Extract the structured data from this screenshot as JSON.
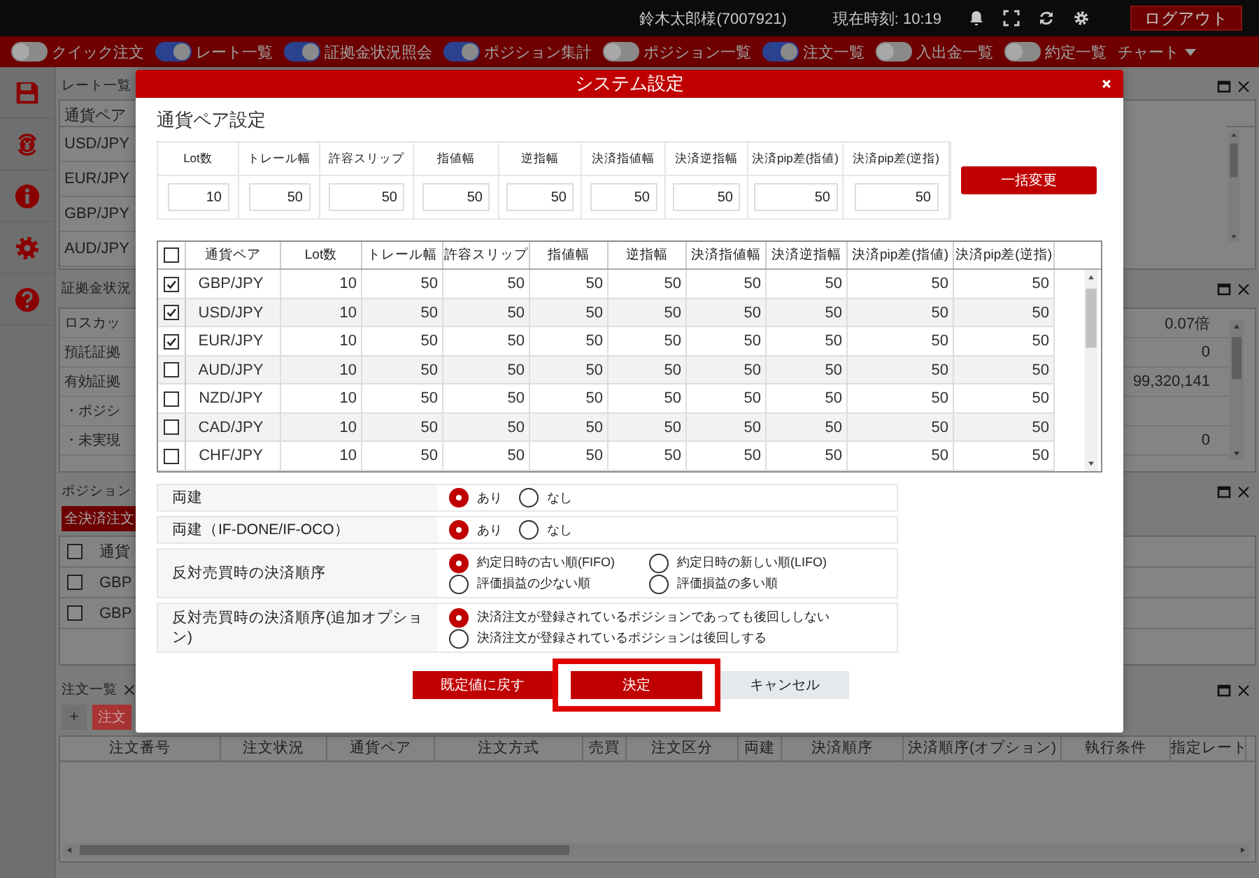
{
  "top_bar": {
    "user": "鈴木太郎様(7007921)",
    "clock": "現在時刻: 10:19",
    "logout": "ログアウト"
  },
  "nav": [
    {
      "label": "クイック注文",
      "kind": "toggle",
      "on": false
    },
    {
      "label": "レート一覧",
      "kind": "toggle",
      "on": true
    },
    {
      "label": "証拠金状況照会",
      "kind": "toggle",
      "on": true
    },
    {
      "label": "ポジション集計",
      "kind": "toggle",
      "on": true
    },
    {
      "label": "ポジション一覧",
      "kind": "toggle",
      "on": false
    },
    {
      "label": "注文一覧",
      "kind": "toggle",
      "on": true
    },
    {
      "label": "入出金一覧",
      "kind": "toggle",
      "on": false
    },
    {
      "label": "約定一覧",
      "kind": "toggle",
      "on": false
    },
    {
      "label": "チャート",
      "kind": "menu"
    }
  ],
  "rate_panel": {
    "title": "レート一覧",
    "column": "通貨ペア",
    "rows": [
      "USD/JPY",
      "EUR/JPY",
      "GBP/JPY",
      "AUD/JPY"
    ]
  },
  "margin_panel": {
    "title": "証拠金状況",
    "rows": [
      {
        "label": "ロスカッ",
        "value": "0.07倍"
      },
      {
        "label": "預託証拠",
        "value": "0"
      },
      {
        "label": "有効証拠",
        "value": "99,320,141"
      },
      {
        "label": "・ポジシ"
      },
      {
        "label": "・未実現",
        "value": "0"
      }
    ]
  },
  "position_panel": {
    "title": "ポジション",
    "button": "全決済注文",
    "column": "通貨",
    "all_checked": false,
    "rows": [
      {
        "pair": "GBP",
        "checked": false
      },
      {
        "pair": "GBP",
        "checked": false
      }
    ]
  },
  "order_panel": {
    "title": "注文一覧",
    "add": "+",
    "button": "注文",
    "columns": [
      "注文番号",
      "注文状況",
      "通貨ペア",
      "注文方式",
      "売買",
      "注文区分",
      "両建",
      "決済順序",
      "決済順序(オプション)",
      "執行条件",
      "指定レート"
    ]
  },
  "dialog": {
    "title": "システム設定",
    "section": "通貨ペア設定",
    "bulk": {
      "columns": [
        "Lot数",
        "トレール幅",
        "許容スリップ",
        "指値幅",
        "逆指幅",
        "決済指値幅",
        "決済逆指幅",
        "決済pip差(指値)",
        "決済pip差(逆指)"
      ],
      "values": [
        "10",
        "50",
        "50",
        "50",
        "50",
        "50",
        "50",
        "50",
        "50"
      ],
      "button": "一括変更"
    },
    "table": {
      "all_checked": false,
      "columns": [
        "通貨ペア",
        "Lot数",
        "トレール幅",
        "許容スリップ",
        "指値幅",
        "逆指幅",
        "決済指値幅",
        "決済逆指幅",
        "決済pip差(指値)",
        "決済pip差(逆指)"
      ],
      "rows": [
        {
          "checked": true,
          "cells": [
            "GBP/JPY",
            "10",
            "50",
            "50",
            "50",
            "50",
            "50",
            "50",
            "50",
            "50"
          ]
        },
        {
          "checked": true,
          "cells": [
            "USD/JPY",
            "10",
            "50",
            "50",
            "50",
            "50",
            "50",
            "50",
            "50",
            "50"
          ]
        },
        {
          "checked": true,
          "cells": [
            "EUR/JPY",
            "10",
            "50",
            "50",
            "50",
            "50",
            "50",
            "50",
            "50",
            "50"
          ]
        },
        {
          "checked": false,
          "cells": [
            "AUD/JPY",
            "10",
            "50",
            "50",
            "50",
            "50",
            "50",
            "50",
            "50",
            "50"
          ]
        },
        {
          "checked": false,
          "cells": [
            "NZD/JPY",
            "10",
            "50",
            "50",
            "50",
            "50",
            "50",
            "50",
            "50",
            "50"
          ]
        },
        {
          "checked": false,
          "cells": [
            "CAD/JPY",
            "10",
            "50",
            "50",
            "50",
            "50",
            "50",
            "50",
            "50",
            "50"
          ]
        },
        {
          "checked": false,
          "cells": [
            "CHF/JPY",
            "10",
            "50",
            "50",
            "50",
            "50",
            "50",
            "50",
            "50",
            "50"
          ]
        }
      ]
    },
    "options": [
      {
        "label": "両建",
        "kind": "inline",
        "choices": [
          {
            "label": "あり",
            "selected": true
          },
          {
            "label": "なし",
            "selected": false
          }
        ]
      },
      {
        "label": "両建（IF-DONE/IF-OCO）",
        "kind": "inline",
        "choices": [
          {
            "label": "あり",
            "selected": true
          },
          {
            "label": "なし",
            "selected": false
          }
        ]
      },
      {
        "label": "反対売買時の決済順序",
        "kind": "grid",
        "choices": [
          {
            "label": "約定日時の古い順(FIFO)",
            "selected": true
          },
          {
            "label": "約定日時の新しい順(LIFO)",
            "selected": false
          },
          {
            "label": "評価損益の少ない順",
            "selected": false
          },
          {
            "label": "評価損益の多い順",
            "selected": false
          }
        ]
      },
      {
        "label": "反対売買時の決済順序(追加オプション)",
        "kind": "stack",
        "choices": [
          {
            "label": "決済注文が登録されているポジションであっても後回ししない",
            "selected": true
          },
          {
            "label": "決済注文が登録されているポジションは後回しする",
            "selected": false
          }
        ]
      }
    ],
    "buttons": [
      {
        "label": "既定値に戻す",
        "kind": "primary",
        "highlighted": false
      },
      {
        "label": "決定",
        "kind": "primary",
        "highlighted": true
      },
      {
        "label": "キャンセル",
        "kind": "secondary",
        "highlighted": false
      }
    ]
  }
}
